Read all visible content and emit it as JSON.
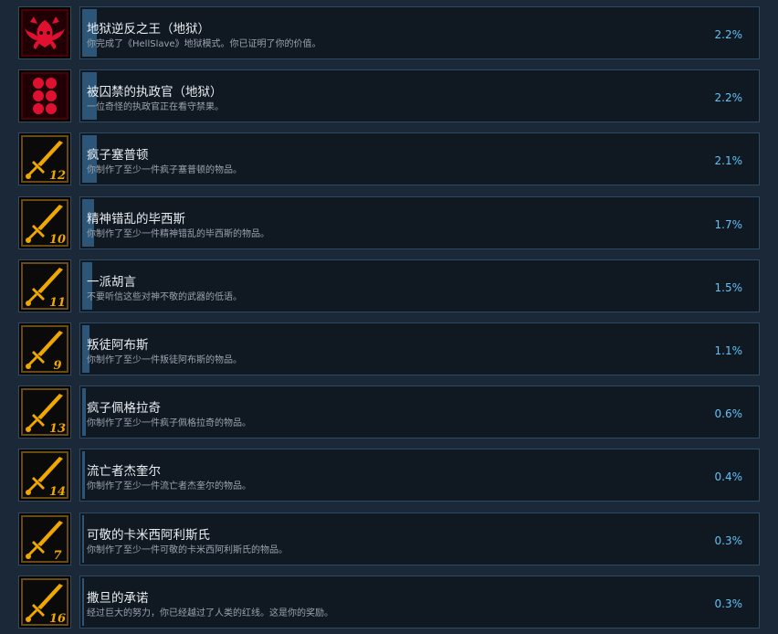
{
  "achievements": [
    {
      "title": "地狱逆反之王（地狱）",
      "desc": "你完成了《HellSlave》地狱模式。你已证明了你的价值。",
      "percent": "2.2%",
      "value": 2.2,
      "icon": "demon-wings-icon",
      "level": ""
    },
    {
      "title": "被囚禁的执政官（地狱）",
      "desc": "一位奇怪的执政官正在看守禁果。",
      "percent": "2.2%",
      "value": 2.2,
      "icon": "six-dots-icon",
      "level": ""
    },
    {
      "title": "疯子塞普顿",
      "desc": "你制作了至少一件疯子塞普顿的物品。",
      "percent": "2.1%",
      "value": 2.1,
      "icon": "golden-sword-icon",
      "level": "12"
    },
    {
      "title": "精神错乱的毕西斯",
      "desc": "你制作了至少一件精神错乱的毕西斯的物品。",
      "percent": "1.7%",
      "value": 1.7,
      "icon": "golden-sword-icon",
      "level": "10"
    },
    {
      "title": "一派胡言",
      "desc": "不要听信这些对神不敬的武器的低语。",
      "percent": "1.5%",
      "value": 1.5,
      "icon": "golden-sword-icon",
      "level": "11"
    },
    {
      "title": "叛徒阿布斯",
      "desc": "你制作了至少一件叛徒阿布斯的物品。",
      "percent": "1.1%",
      "value": 1.1,
      "icon": "golden-sword-icon",
      "level": "9"
    },
    {
      "title": "疯子佩格拉奇",
      "desc": "你制作了至少一件疯子佩格拉奇的物品。",
      "percent": "0.6%",
      "value": 0.6,
      "icon": "golden-sword-icon",
      "level": "13"
    },
    {
      "title": "流亡者杰奎尔",
      "desc": "你制作了至少一件流亡者杰奎尔的物品。",
      "percent": "0.4%",
      "value": 0.4,
      "icon": "golden-sword-icon",
      "level": "14"
    },
    {
      "title": "可敬的卡米西阿利斯氏",
      "desc": "你制作了至少一件可敬的卡米西阿利斯氏的物品。",
      "percent": "0.3%",
      "value": 0.3,
      "icon": "golden-sword-icon",
      "level": "7"
    },
    {
      "title": "撒旦的承诺",
      "desc": "经过巨大的努力，你已经越过了人类的红线。这是你的奖励。",
      "percent": "0.3%",
      "value": 0.3,
      "icon": "golden-sword-icon",
      "level": "16"
    }
  ],
  "colors": {
    "background": "#1b2838",
    "accent": "#66c0f4",
    "progress": "#2d5577",
    "gold": "#f0a800",
    "red": "#e01030"
  }
}
